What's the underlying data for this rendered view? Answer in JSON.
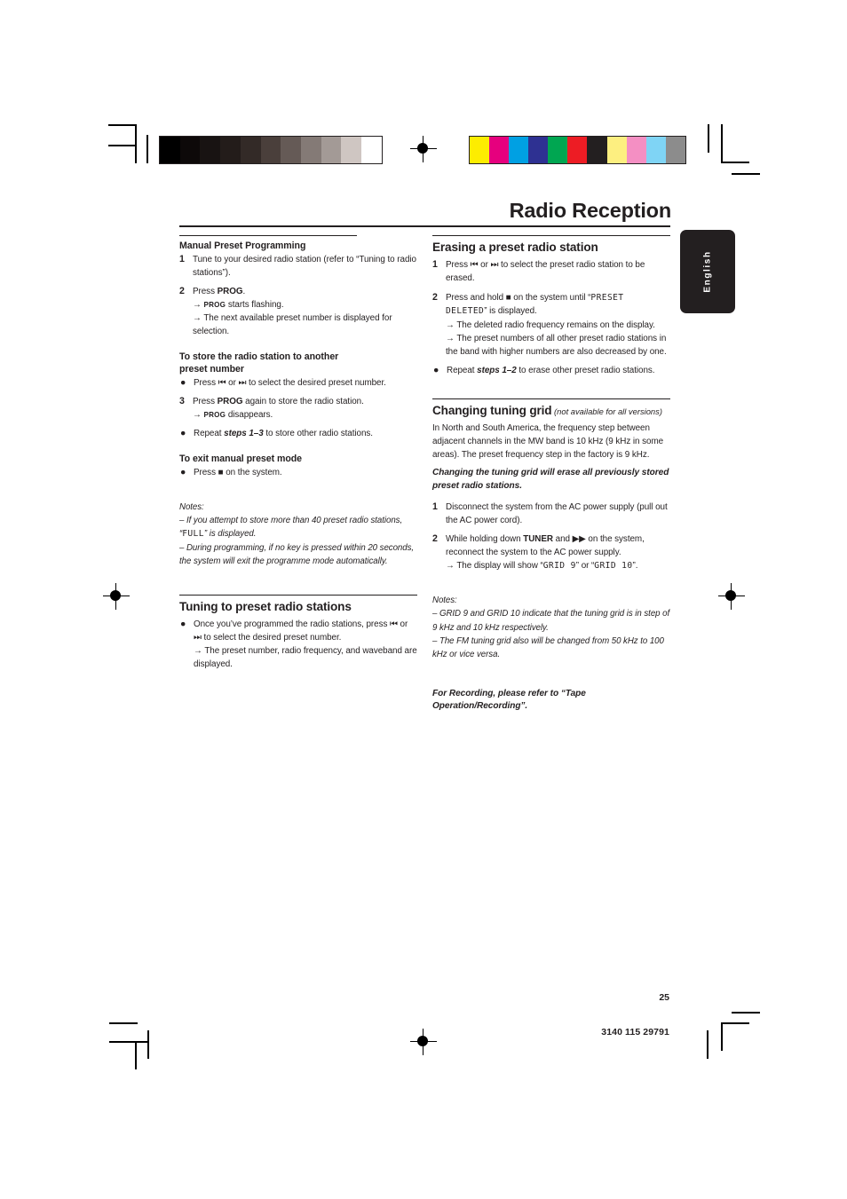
{
  "page": {
    "title": "Radio Reception",
    "language_tab": "English",
    "page_number": "25",
    "doc_code": "3140 115 29791"
  },
  "marks": {
    "gray_ramp": [
      "#000000",
      "#0d0909",
      "#181312",
      "#231c1a",
      "#332a27",
      "#4a3f3b",
      "#655a56",
      "#847a76",
      "#a39a96",
      "#cfc6c2",
      "#ffffff"
    ],
    "color_bar": [
      "#fded00",
      "#e6007e",
      "#00a0e3",
      "#2e3192",
      "#00a651",
      "#ed1c24",
      "#231f20",
      "#fdef80",
      "#f municipality",
      "#7fd4f5",
      "#8c8c8c"
    ],
    "color_bar_fixed": [
      "#fded00",
      "#e6007e",
      "#00a0e3",
      "#2e3192",
      "#00a651",
      "#ed1c24",
      "#231f20",
      "#fdef80",
      "#f48fc3",
      "#7fd4f5",
      "#8c8c8c"
    ]
  },
  "left_column": {
    "section1": {
      "heading": "Manual Preset Programming",
      "steps": [
        {
          "num": "1",
          "text": "Tune to your desired radio station (refer to “Tuning to radio stations”)."
        }
      ],
      "step2_num": "2",
      "step2_pre": "Press ",
      "step2_bold": "PROG",
      "step2_post": ".",
      "step2_arrow1_pre": "→ ",
      "step2_arrow1_sc": "PROG",
      "step2_arrow1_post": " starts flashing.",
      "step2_arrow2": "→ The next available preset number is displayed for selection."
    },
    "section2": {
      "heading_line1": "To store the radio station to another",
      "heading_line2": "preset number",
      "bullet1_pre": "Press ",
      "bullet1_icon_prev": "⏮",
      "bullet1_mid": " or ",
      "bullet1_icon_next": "⏭",
      "bullet1_post": " to select the desired preset number.",
      "step3_num": "3",
      "step3_pre": "Press ",
      "step3_bold": "PROG",
      "step3_post": " again to store the radio station.",
      "step3_arrow_pre": "→ ",
      "step3_arrow_sc": "PROG",
      "step3_arrow_post": " disappears.",
      "bullet2_pre": "Repeat ",
      "bullet2_bold": "steps 1–3",
      "bullet2_post": " to store other radio stations."
    },
    "section3": {
      "heading": "To exit manual preset mode",
      "bullet_pre": "Press ",
      "bullet_icon_stop": "■",
      "bullet_post": " on the system."
    },
    "notes": {
      "label": "Notes:",
      "note1_pre": "–  If you attempt to store more than 40 preset radio stations, “",
      "note1_lcd": "FULL",
      "note1_post": "” is displayed.",
      "note2": "–  During programming, if no key is pressed within 20 seconds, the system will exit the programme mode automatically."
    },
    "section4": {
      "heading": "Tuning to preset radio stations",
      "bullet_pre": "Once you’ve programmed the radio stations, press ",
      "bullet_icon_prev": "⏮",
      "bullet_mid": " or ",
      "bullet_icon_next": "⏭",
      "bullet_post": " to select the desired preset number.",
      "arrow": "→ The preset number, radio frequency, and waveband are displayed."
    }
  },
  "right_column": {
    "section1": {
      "heading": "Erasing a preset radio station",
      "step1_num": "1",
      "step1_pre": "Press ",
      "step1_icon_prev": "⏮",
      "step1_mid": " or ",
      "step1_icon_next": "⏭",
      "step1_post": " to select the preset radio station to be erased.",
      "step2_num": "2",
      "step2_pre": "Press and hold ",
      "step2_icon_stop": "■",
      "step2_mid": " on the system until “",
      "step2_lcd": "PRESET DELETED",
      "step2_post": "” is displayed.",
      "step2_arrow1": "→ The deleted radio frequency remains on the display.",
      "step2_arrow2": "→ The preset numbers of all other preset radio stations in the band with higher numbers are also decreased by one.",
      "bullet_pre": "Repeat ",
      "bullet_bold": "steps 1–2",
      "bullet_post": " to erase other preset radio stations."
    },
    "section2": {
      "heading": "Changing tuning grid",
      "heading_note": " (not available for all versions)",
      "paragraph": "In North and South America, the frequency step between adjacent channels in the MW band is 10 kHz (9 kHz in some areas). The preset frequency step in the factory is 9 kHz.",
      "warning": "Changing the tuning grid will erase all previously stored preset radio stations.",
      "step1_num": "1",
      "step1_text": "Disconnect the system from the AC power supply (pull out the AC power cord).",
      "step2_num": "2",
      "step2_pre": "While holding down ",
      "step2_bold": "TUNER",
      "step2_mid": " and ",
      "step2_icon_ff": "▶▶",
      "step2_post": " on the system, reconnect the system to the AC power supply.",
      "step2_arrow_pre": "→ The display will show “",
      "step2_arrow_lcd1": "GRID 9",
      "step2_arrow_mid": "” or “",
      "step2_arrow_lcd2": "GRID 10",
      "step2_arrow_post": "”."
    },
    "notes": {
      "label": "Notes:",
      "note1": "–  GRID 9 and GRID 10 indicate that the tuning grid is in step of 9 kHz and 10 kHz respectively.",
      "note2": "–  The FM tuning grid also will be changed from 50 kHz to 100 kHz or vice versa."
    },
    "footer_note": "For Recording, please refer to “Tape Operation/Recording”."
  }
}
